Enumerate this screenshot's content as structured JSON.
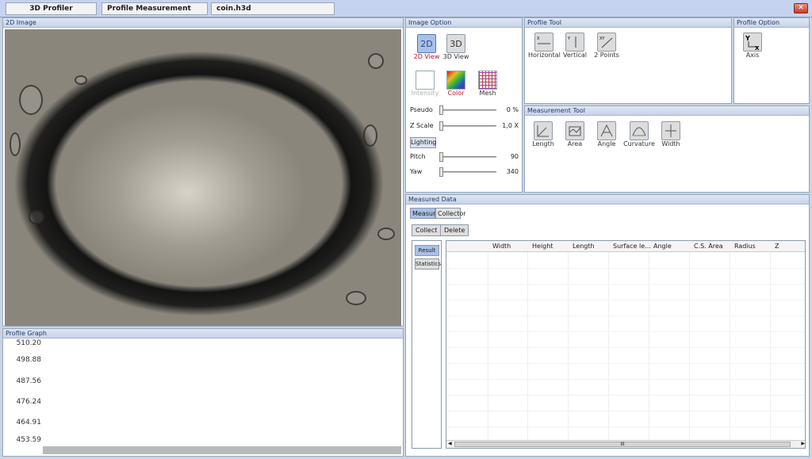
{
  "tabs": [
    {
      "label": "3D Profiler"
    },
    {
      "label": "Profile Measurement"
    },
    {
      "label": "coin.h3d"
    }
  ],
  "window": {
    "close_label": "✕"
  },
  "image_panel": {
    "title": "2D Image"
  },
  "profile_graph": {
    "title": "Profile Graph",
    "y_ticks": [
      "510.20",
      "498.88",
      "487.56",
      "476.24",
      "464.91",
      "453.59"
    ]
  },
  "image_option": {
    "title": "Image Option",
    "view_2d": {
      "icon": "2D",
      "label": "2D View"
    },
    "view_3d": {
      "icon": "3D",
      "label": "3D View"
    },
    "intensity_label": "Intensity",
    "color_label": "Color",
    "mesh_label": "Mesh",
    "pseudo": {
      "label": "Pseudo",
      "value": "0 %"
    },
    "zscale": {
      "label": "Z Scale",
      "value": "1,0 X"
    },
    "lighting_label": "Lighting",
    "pitch": {
      "label": "Pitch",
      "value": "90"
    },
    "yaw": {
      "label": "Yaw",
      "value": "340"
    }
  },
  "profile_tool": {
    "title": "Profile Tool",
    "horizontal": {
      "icon_text": "X",
      "label": "Horizontal"
    },
    "vertical": {
      "icon_text": "Y",
      "label": "Vertical"
    },
    "two_points": {
      "icon_text": "XY",
      "label": "2 Points"
    }
  },
  "profile_option": {
    "title": "Profile Option",
    "axis": {
      "icon_text": "Y",
      "icon_text_x": "X",
      "label": "Axis"
    }
  },
  "measurement_tool": {
    "title": "Measurement Tool",
    "length_label": "Length",
    "area_label": "Area",
    "angle_label": "Angle",
    "curvature_label": "Curvature",
    "width_label": "Width"
  },
  "measured_data": {
    "title": "Measured Data",
    "tab_measure": "Measure",
    "tab_collector": "Collector",
    "collect_label": "Collect",
    "delete_label": "Delete",
    "result_label": "Result",
    "statistics_label": "Statistics",
    "columns": [
      "Width",
      "Height",
      "Length",
      "Surface le...",
      "Angle",
      "C.S. Area",
      "Radius",
      "Z"
    ],
    "scroll_grip": "III"
  }
}
